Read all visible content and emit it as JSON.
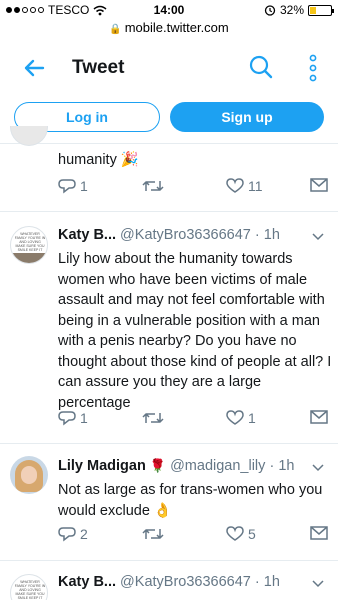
{
  "status_bar": {
    "carrier": "TESCO",
    "time": "14:00",
    "battery": "32%",
    "battery_level": 0.32
  },
  "url_bar": {
    "url": "mobile.twitter.com"
  },
  "header": {
    "title": "Tweet"
  },
  "auth": {
    "login_label": "Log in",
    "signup_label": "Sign up"
  },
  "tweets": [
    {
      "text": "humanity 🎉",
      "replies": "1",
      "retweets": "",
      "likes": "11"
    },
    {
      "name": "Katy B...",
      "handle": "@KatyBro36366647",
      "separator": "·",
      "time": "1h",
      "avatar_text": "WHATEVER FAMILY YOU'RE IN AND LOVING MAKE SURE YOU SMILE KEEP IT",
      "text": "Lily how about the humanity towards women who have been victims of male assault and may not feel comfortable with being in a vulnerable position with a man with a penis nearby? Do you have no thought about those kind of people at all? I can assure you they are a large percentage",
      "replies": "1",
      "retweets": "",
      "likes": "1"
    },
    {
      "name": "Lily Madigan",
      "name_emoji": "🌹",
      "handle": "@madigan_lily",
      "separator": "·",
      "time": "1h",
      "text": "Not as large as for trans-women who you would exclude 👌",
      "replies": "2",
      "retweets": "",
      "likes": "5"
    },
    {
      "name": "Katy B...",
      "handle": "@KatyBro36366647",
      "separator": "·",
      "time": "1h",
      "avatar_text": "WHATEVER FAMILY YOU'RE IN AND LOVING MAKE SURE YOU SMILE KEEP IT"
    }
  ],
  "colors": {
    "accent": "#1da1f2",
    "text": "#14171a",
    "secondary": "#657786",
    "divider": "#e6ecf0"
  },
  "icons": {
    "back": "back-arrow-icon",
    "search": "search-icon",
    "more": "more-vertical-icon",
    "reply": "reply-icon",
    "retweet": "retweet-icon",
    "like": "heart-icon",
    "message": "envelope-icon",
    "caret": "chevron-down-icon"
  }
}
